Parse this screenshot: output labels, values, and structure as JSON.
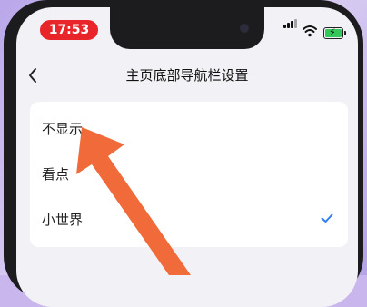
{
  "status_bar": {
    "time": "17:53",
    "signal_icon": "cellular-signal-icon",
    "wifi_icon": "wifi-icon",
    "battery_icon": "battery-charging-icon"
  },
  "nav": {
    "back_icon": "chevron-left-icon",
    "title": "主页底部导航栏设置"
  },
  "options": [
    {
      "label": "不显示",
      "selected": false
    },
    {
      "label": "看点",
      "selected": false
    },
    {
      "label": "小世界",
      "selected": true
    }
  ],
  "colors": {
    "time_pill": "#e8262a",
    "check": "#2f7cf6",
    "arrow": "#f06a3a",
    "battery": "#34c759"
  }
}
